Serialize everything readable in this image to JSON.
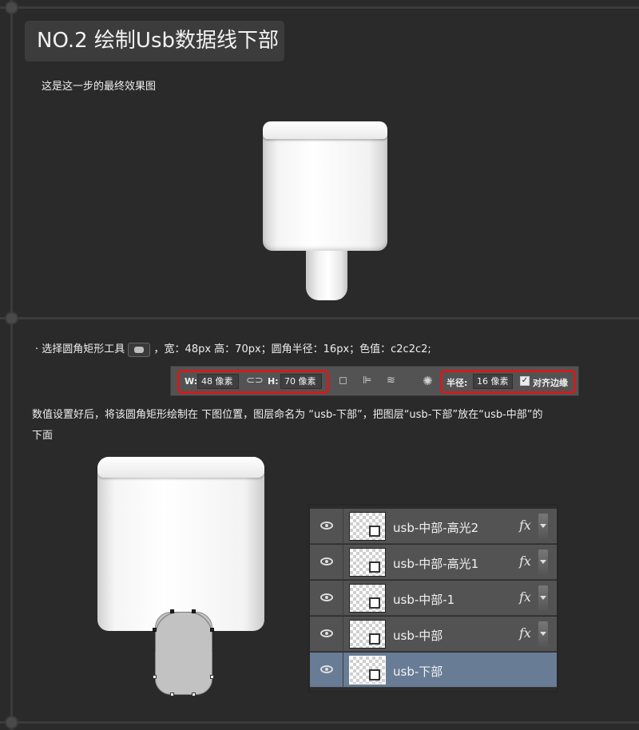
{
  "title": "NO.2 绘制Usb数据线下部",
  "intro": "这是这一步的最终效果图",
  "instruction": {
    "prefix": "· 选择圆角矩形工具",
    "tool_icon": "rounded-rectangle-tool-icon",
    "suffix": "，宽：48px 高：70px；圆角半径：16px；色值：c2c2c2;"
  },
  "options_bar": {
    "w_label": "W:",
    "w_value": "48 像素",
    "link_icon": "link-icon",
    "h_label": "H:",
    "h_value": "70 像素",
    "radius_label": "半径:",
    "radius_value": "16 像素",
    "align_label": "对齐边缘",
    "align_checked": true,
    "highlight_color": "#cc1e1e"
  },
  "note_line1": "数值设置好后，将该圆角矩形绘制在 下图位置，图层命名为 “usb-下部”，把图层“usb-下部”放在“usb-中部”的",
  "note_line2": "下面",
  "shape_color": "#c2c2c2",
  "layers": [
    {
      "name": "usb-中部-高光2",
      "fx": "fx",
      "selected": false
    },
    {
      "name": "usb-中部-高光1",
      "fx": "fx",
      "selected": false
    },
    {
      "name": "usb-中部-1",
      "fx": "fx",
      "selected": false
    },
    {
      "name": "usb-中部",
      "fx": "fx",
      "selected": false
    },
    {
      "name": "usb-下部",
      "fx": "",
      "selected": true
    }
  ],
  "selected_layer_color": "#687c95"
}
